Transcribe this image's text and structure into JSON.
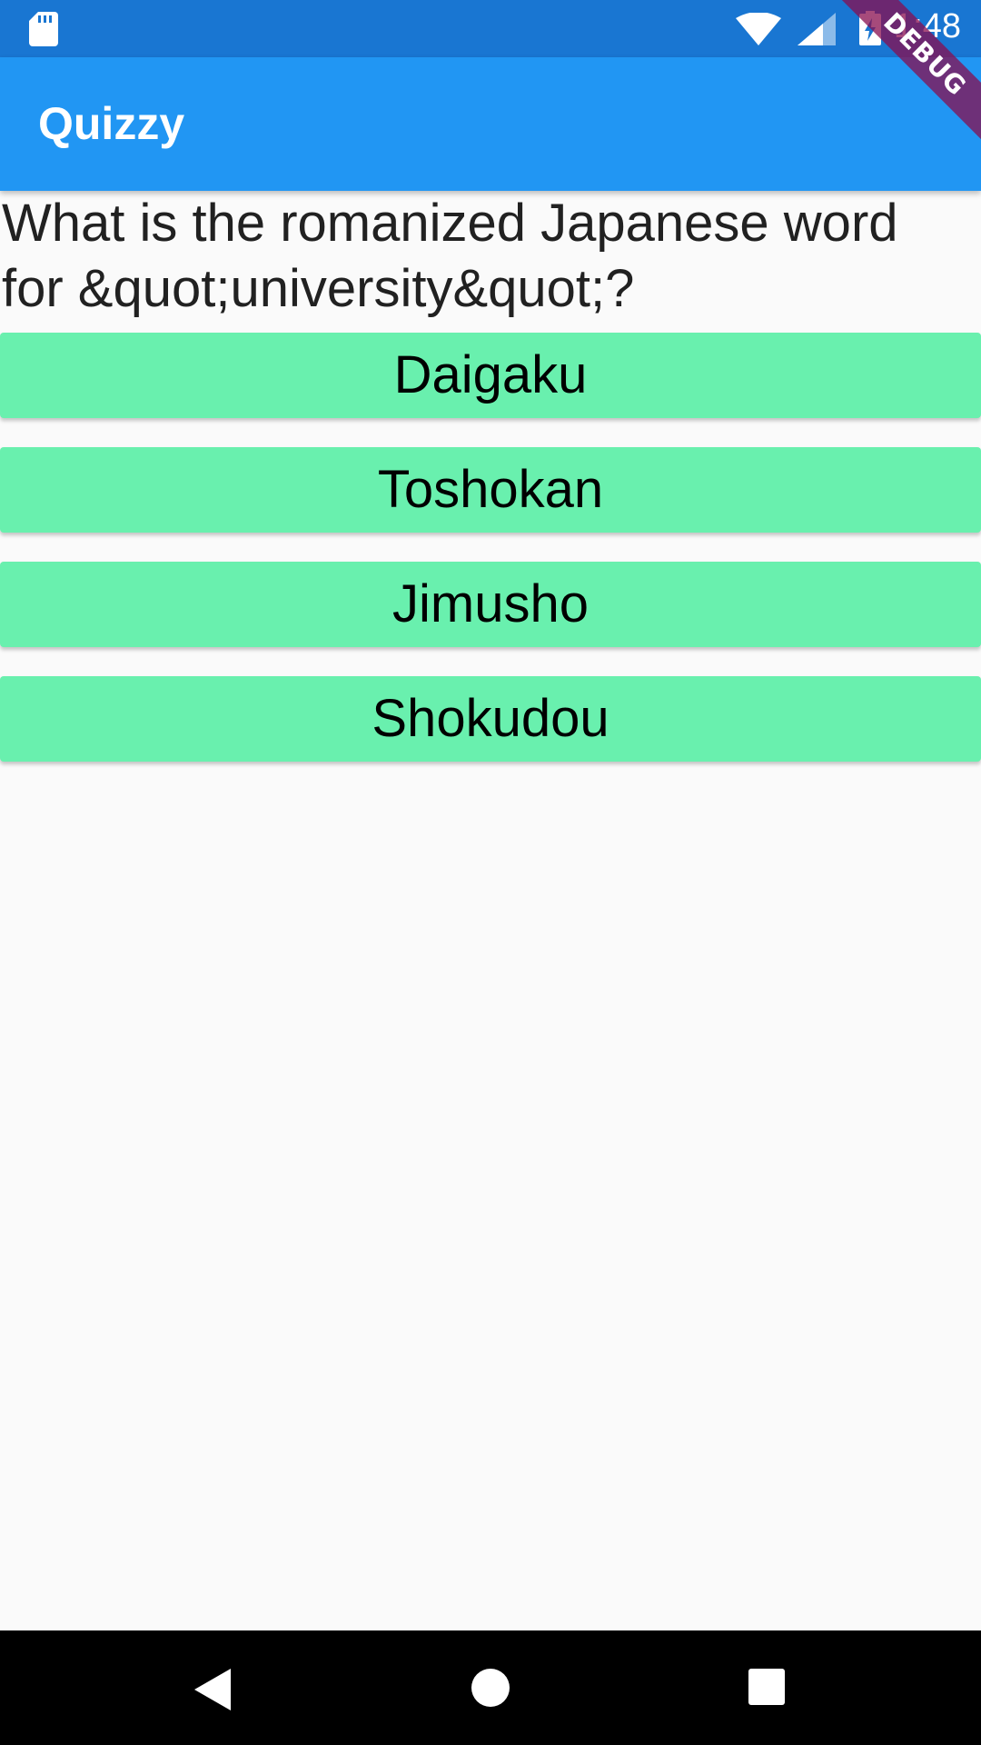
{
  "status_bar": {
    "time": "1:48",
    "icons": [
      "sd-card-icon",
      "wifi-icon",
      "signal-icon",
      "battery-charging-icon"
    ]
  },
  "app_bar": {
    "title": "Quizzy"
  },
  "debug_banner": {
    "label": "DEBUG"
  },
  "quiz": {
    "question": "What is the romanized Japanese word for &quot;university&quot;?",
    "answers": [
      "Daigaku",
      "Toshokan",
      "Jimusho",
      "Shokudou"
    ]
  },
  "colors": {
    "status_bar": "#1976d2",
    "app_bar": "#2196f3",
    "answer_button": "#69f0ae",
    "background": "#fafafa",
    "debug_ribbon": "#880e4f"
  },
  "nav_bar": {
    "icons": [
      "back-icon",
      "home-icon",
      "recents-icon"
    ]
  }
}
